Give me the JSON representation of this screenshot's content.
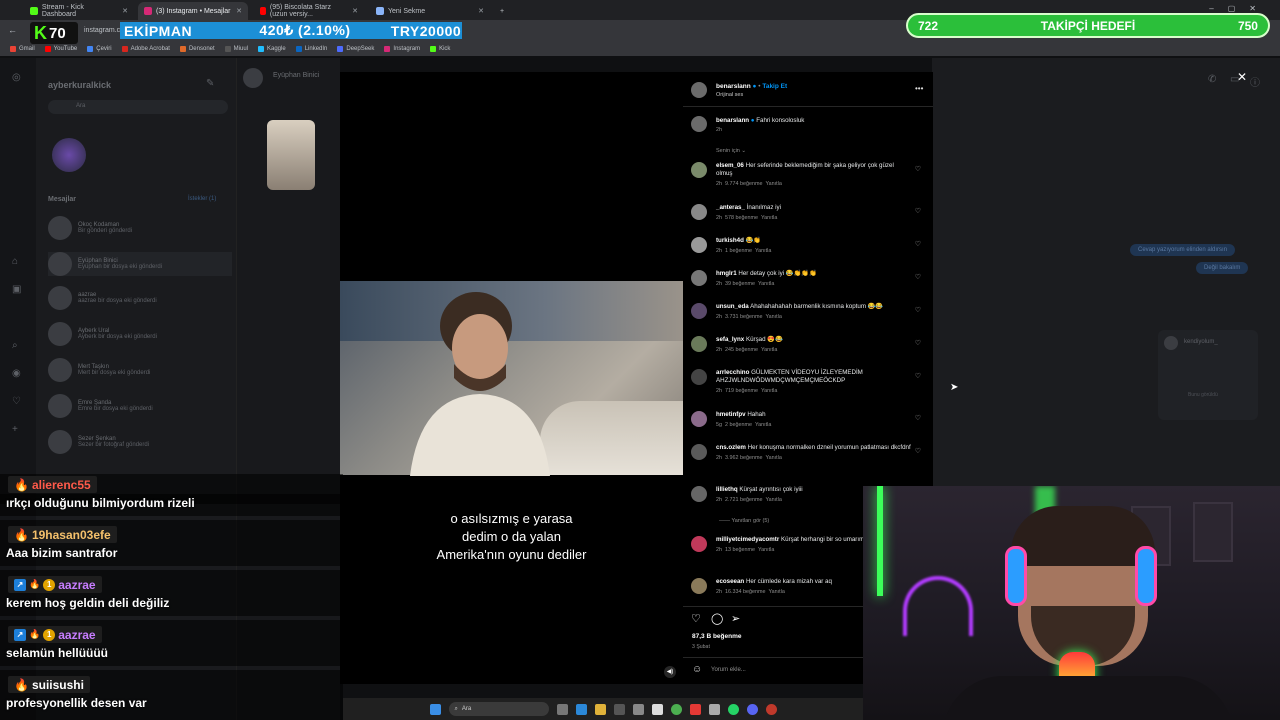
{
  "browser": {
    "tabs": [
      {
        "title": "Stream - Kick Dashboard",
        "color": "#53fc18"
      },
      {
        "title": "(3) Instagram • Mesajlar",
        "color": "#d62976"
      },
      {
        "title": "(95) Biscolata Starz (uzun versiy...",
        "color": "#ff0000"
      },
      {
        "title": "Yeni Sekme",
        "color": "#8ab4f8"
      }
    ],
    "url": "instagram.com",
    "bookmarks": [
      "Gmail",
      "YouTube",
      "Çeviri",
      "Adobe Acrobat",
      "Densonet",
      "Miuul",
      "Kaggle",
      "LinkedIn",
      "DeepSeek",
      "Instagram",
      "Kick"
    ]
  },
  "overlay": {
    "kick_count": "70",
    "ekipman_label": "EKİPMAN",
    "ekipman_value": "420₺ (2.10%)",
    "ekipman_goal": "TRY20000",
    "goal_current": "722",
    "goal_label": "TAKİPÇİ HEDEFİ",
    "goal_target": "750"
  },
  "instagram": {
    "account": "ayberkuralkick",
    "search_placeholder": "Ara",
    "messages_label": "Mesajlar",
    "requests_label": "İstekler (1)",
    "conversation_user": "Eyüphan Binici",
    "inbox": [
      {
        "name": "Okoç Kodaman",
        "preview": "Bir gönderi gönderdi"
      },
      {
        "name": "Eyüphan Binici",
        "preview": "Eyüphan bir dosya eki gönderdi"
      },
      {
        "name": "aazrae",
        "preview": "aazrae bir dosya eki gönderdi"
      },
      {
        "name": "Ayberk Ural",
        "preview": "Ayberk bir dosya eki gönderdi"
      },
      {
        "name": "Mert Taşkın",
        "preview": "Mert bir dosya eki gönderdi"
      },
      {
        "name": "Emre Şanda",
        "preview": "Emre bir dosya eki gönderdi"
      },
      {
        "name": "Sezer Şenkan",
        "preview": "Sezer bir fotoğraf gönderdi"
      }
    ]
  },
  "post": {
    "author": "benarslann",
    "follow_label": "Takip Et",
    "audio": "Orijinal ses",
    "caption_author": "benarslann",
    "caption_text": "Fahri konsolosluk",
    "caption_time": "2h",
    "for_you": "Senin için",
    "subtitle_lines": [
      "o asılsızmış e yarasa",
      "dedim o da yalan",
      "Amerika'nın oyunu dediler"
    ],
    "likes": "87,3 B beğenme",
    "date": "3 Şubat",
    "comment_placeholder": "Yorum ekle...",
    "view_replies": "Yanıtları gör (5)",
    "comments": [
      {
        "user": "elsem_06",
        "text": "Her seferinde beklemediğim bir şaka geliyor çok güzel olmuş",
        "time": "2h",
        "likes": "9.774 beğenme",
        "reply": "Yanıtla"
      },
      {
        "user": "_anteras_",
        "text": "İnanılmaz iyi",
        "time": "2h",
        "likes": "578 beğenme",
        "reply": "Yanıtla"
      },
      {
        "user": "turkish4d",
        "text": "😂👏",
        "time": "2h",
        "likes": "1 beğenme",
        "reply": "Yanıtla"
      },
      {
        "user": "hmglr1",
        "text": "Her detay çok iyi 😂👏👏👏",
        "time": "2h",
        "likes": "39 beğenme",
        "reply": "Yanıtla"
      },
      {
        "user": "unsun_eda",
        "text": "Ahahahahahah barmenlik kısmına koptum 😂😂",
        "time": "2h",
        "likes": "3.731 beğenme",
        "reply": "Yanıtla"
      },
      {
        "user": "sefa_lynx",
        "text": "Kürşad 😍😂",
        "time": "2h",
        "likes": "245 beğenme",
        "reply": "Yanıtla"
      },
      {
        "user": "arrlecchino",
        "text": "GÜLMEKTEN VİDEOYU İZLEYEMEDİM AHZJWLNDWÖDWMDÇWMÇEMÇMEÖCKDP",
        "time": "2h",
        "likes": "719 beğenme",
        "reply": "Yanıtla"
      },
      {
        "user": "hmetinfpv",
        "text": "Hahah",
        "time": "5g",
        "likes": "2 beğenme",
        "reply": "Yanıtla"
      },
      {
        "user": "cns.ozlem",
        "text": "Her konuşma normalken dzneil yorumun patlatması dkcfdnf",
        "time": "2h",
        "likes": "3.962 beğenme",
        "reply": "Yanıtla"
      },
      {
        "user": "lilliethq",
        "text": "Kürşat ayrıntısı çok iyiii",
        "time": "2h",
        "likes": "2.721 beğenme",
        "reply": "Yanıtla"
      },
      {
        "user": "milliyetcimedyacomtr",
        "text": "Kürşat herhangi bir so umarım. 😂",
        "time": "2h",
        "likes": "13 beğenme",
        "reply": "Yanıtla"
      },
      {
        "user": "ecoseean",
        "text": "Her cümlede kara mizah var aq",
        "time": "2h",
        "likes": "16.334 beğenme",
        "reply": "Yanıtla"
      }
    ]
  },
  "chat": [
    {
      "user": "alierenc55",
      "user_color": "#ff5a4a",
      "message": "ırkçı olduğunu bilmiyordum rizeli",
      "badges": [
        "flame"
      ]
    },
    {
      "user": "19hasan03efe",
      "user_color": "#f5c16c",
      "message": "Aaa bizim santrafor",
      "badges": [
        "flame"
      ]
    },
    {
      "user": "aazrae",
      "user_color": "#c77dff",
      "message": "kerem hoş geldin deli değiliz",
      "badges": [
        "vip",
        "flame",
        "gift"
      ]
    },
    {
      "user": "aazrae",
      "user_color": "#c77dff",
      "message": "selamün hellüüüü",
      "badges": [
        "vip",
        "flame",
        "gift"
      ]
    },
    {
      "user": "suiisushi",
      "user_color": "#ffffff",
      "message": "profesyonellik desen var",
      "badges": [
        "flame"
      ]
    }
  ],
  "right_panel": {
    "bubble_1": "Cevap yazıyorum elinden aldırsın",
    "bubble_2": "Değil bakalım",
    "user": "kendiyolum_",
    "seen": "Bunu görüldü"
  },
  "taskbar": {
    "search": "Ara"
  },
  "colors": {
    "kick_green": "#53fc18",
    "instagram_blue": "#0095f6",
    "goal_green": "#2bbf3a",
    "ekipman_blue": "#1c8fd6"
  }
}
